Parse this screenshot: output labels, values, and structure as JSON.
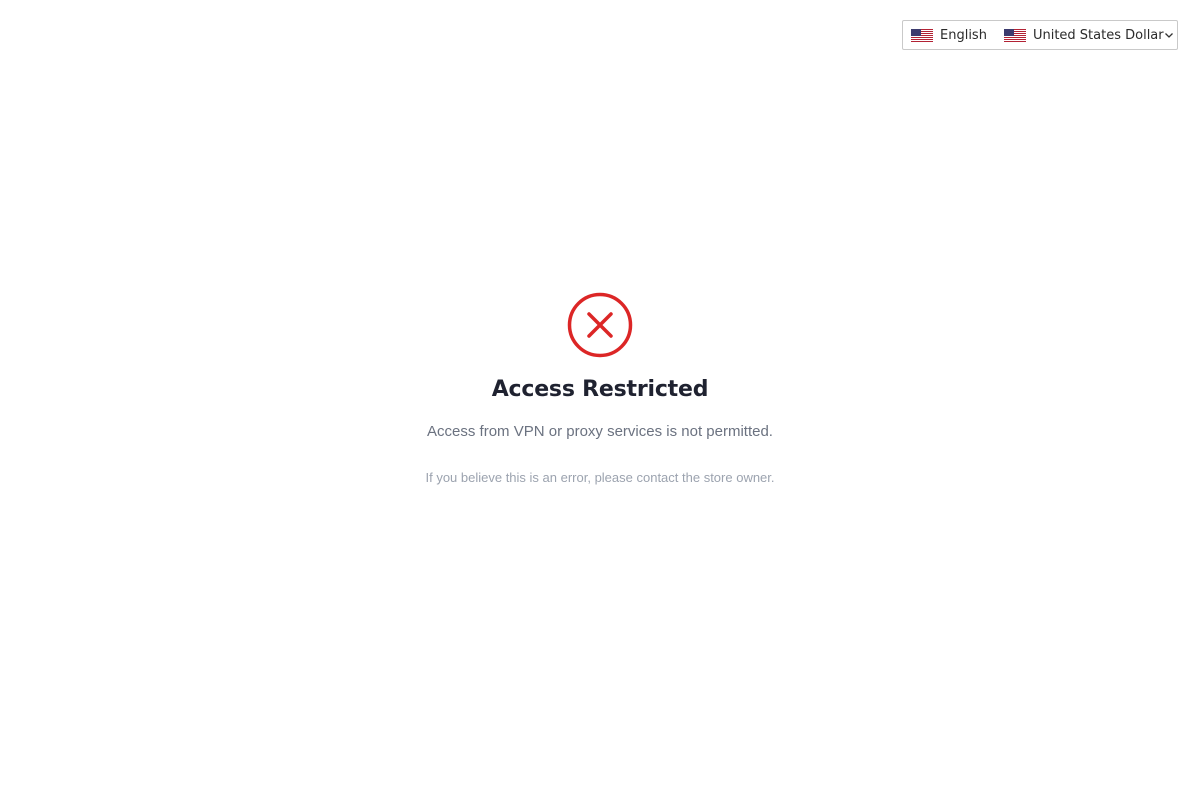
{
  "locale_switcher": {
    "language_label": "English",
    "currency_label": "United States Dollar",
    "language_flag_icon": "us-flag-icon",
    "currency_flag_icon": "us-flag-icon",
    "dropdown_icon": "chevron-down-icon"
  },
  "notice": {
    "icon": "x-circle-icon",
    "icon_color": "#dc2626",
    "title": "Access Restricted",
    "message": "Access from VPN or proxy services is not permitted.",
    "note": "If you believe this is an error, please contact the store owner."
  }
}
